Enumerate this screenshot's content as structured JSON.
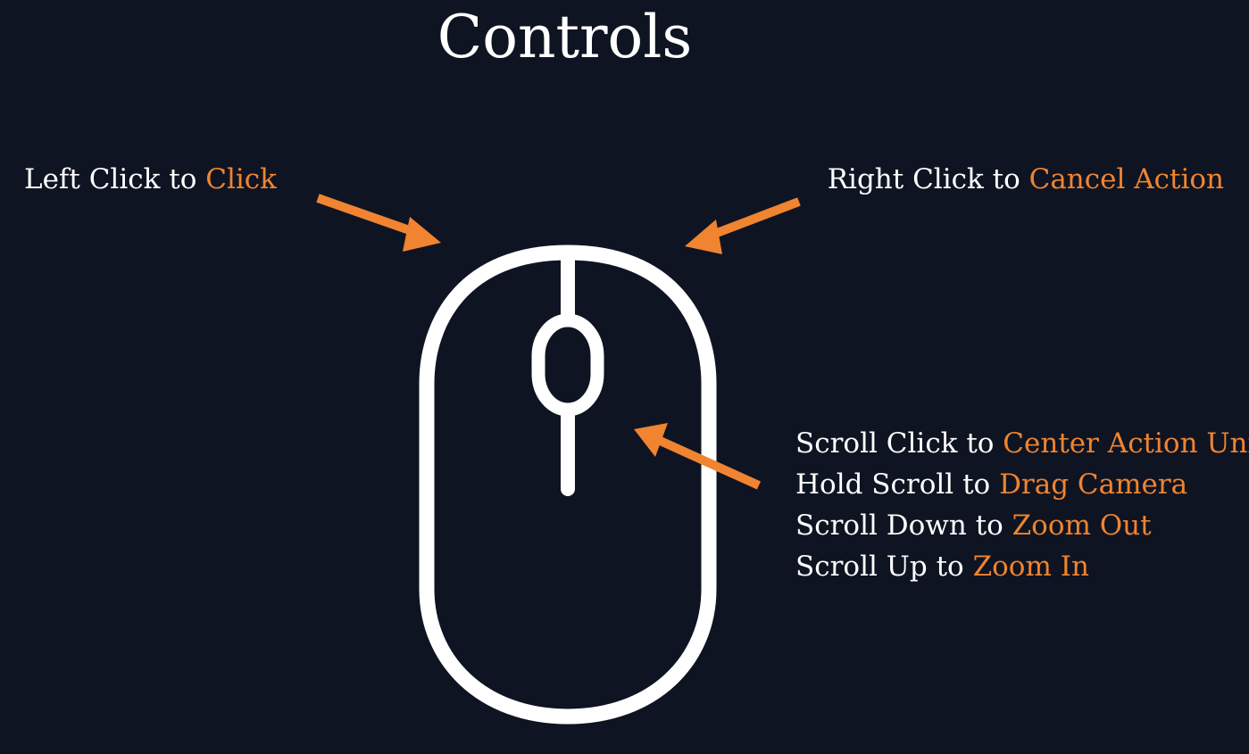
{
  "title": "Controls",
  "colors": {
    "background": "#0f1422",
    "text": "#ffffff",
    "accent": "#f08430"
  },
  "left_click": {
    "prefix": "Left Click to ",
    "action": "Click"
  },
  "right_click": {
    "prefix": "Right Click to ",
    "action": "Cancel Action"
  },
  "scroll_controls": [
    {
      "prefix": "Scroll Click to ",
      "action": "Center Action Unit"
    },
    {
      "prefix": "Hold Scroll to ",
      "action": "Drag Camera"
    },
    {
      "prefix": "Scroll Down to ",
      "action": "Zoom Out"
    },
    {
      "prefix": "Scroll Up to ",
      "action": "Zoom In"
    }
  ],
  "icons": {
    "mouse": "mouse-icon",
    "arrow": "arrow-icon"
  }
}
